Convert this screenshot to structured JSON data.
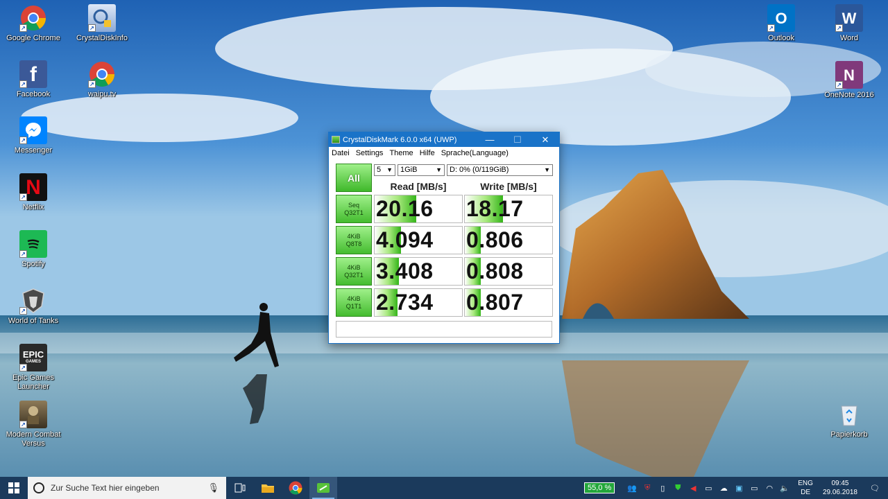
{
  "desktop": {
    "icons_left": [
      {
        "label": "Google Chrome",
        "icon": "chrome-icon"
      },
      {
        "label": "CrystalDiskInfo",
        "icon": "crystaldiskinfo-icon"
      },
      {
        "label": "Facebook",
        "icon": "facebook-icon"
      },
      {
        "label": "waipu.tv",
        "icon": "chrome-icon"
      },
      {
        "label": "Messenger",
        "icon": "messenger-icon"
      },
      {
        "label": "Netflix",
        "icon": "netflix-icon"
      },
      {
        "label": "Spotify",
        "icon": "spotify-icon"
      },
      {
        "label": "World of Tanks",
        "icon": "world-of-tanks-icon"
      },
      {
        "label": "Epic Games Launcher",
        "icon": "epic-games-icon"
      },
      {
        "label": "Modern Combat Versus",
        "icon": "modern-combat-icon"
      }
    ],
    "icons_right": [
      {
        "label": "Outlook",
        "icon": "outlook-icon"
      },
      {
        "label": "Word",
        "icon": "word-icon"
      },
      {
        "label": "OneNote 2016",
        "icon": "onenote-icon"
      },
      {
        "label": "Papierkorb",
        "icon": "recycle-bin-icon"
      }
    ],
    "epic_text": "EPIC",
    "epic_sub": "GAMES"
  },
  "window": {
    "title": "CrystalDiskMark 6.0.0 x64 (UWP)",
    "minimize": "—",
    "maximize": "☐",
    "close": "✕",
    "menu": [
      "Datei",
      "Settings",
      "Theme",
      "Hilfe",
      "Sprache(Language)"
    ],
    "all_label": "All",
    "count_select": "5",
    "size_select": "1GiB",
    "drive_select": "D: 0% (0/119GiB)",
    "read_header": "Read [MB/s]",
    "write_header": "Write [MB/s]",
    "rows": [
      {
        "line1": "Seq",
        "line2": "Q32T1",
        "read": "20.16",
        "write": "18.17",
        "read_fill": 0.48,
        "write_fill": 0.44
      },
      {
        "line1": "4KiB",
        "line2": "Q8T8",
        "read": "4.094",
        "write": "0.806",
        "read_fill": 0.3,
        "write_fill": 0.18
      },
      {
        "line1": "4KiB",
        "line2": "Q32T1",
        "read": "3.408",
        "write": "0.808",
        "read_fill": 0.28,
        "write_fill": 0.18
      },
      {
        "line1": "4KiB",
        "line2": "Q1T1",
        "read": "2.734",
        "write": "0.807",
        "read_fill": 0.26,
        "write_fill": 0.18
      }
    ]
  },
  "taskbar": {
    "search_placeholder": "Zur Suche Text hier eingeben",
    "battery": "55,0 %",
    "lang_top": "ENG",
    "lang_bottom": "DE",
    "time": "09:45",
    "date": "29.06.2018"
  },
  "colors": {
    "titlebar": "#1a73c8",
    "taskbar": "#1b3a5c",
    "green_accent": "#3fb82a"
  }
}
